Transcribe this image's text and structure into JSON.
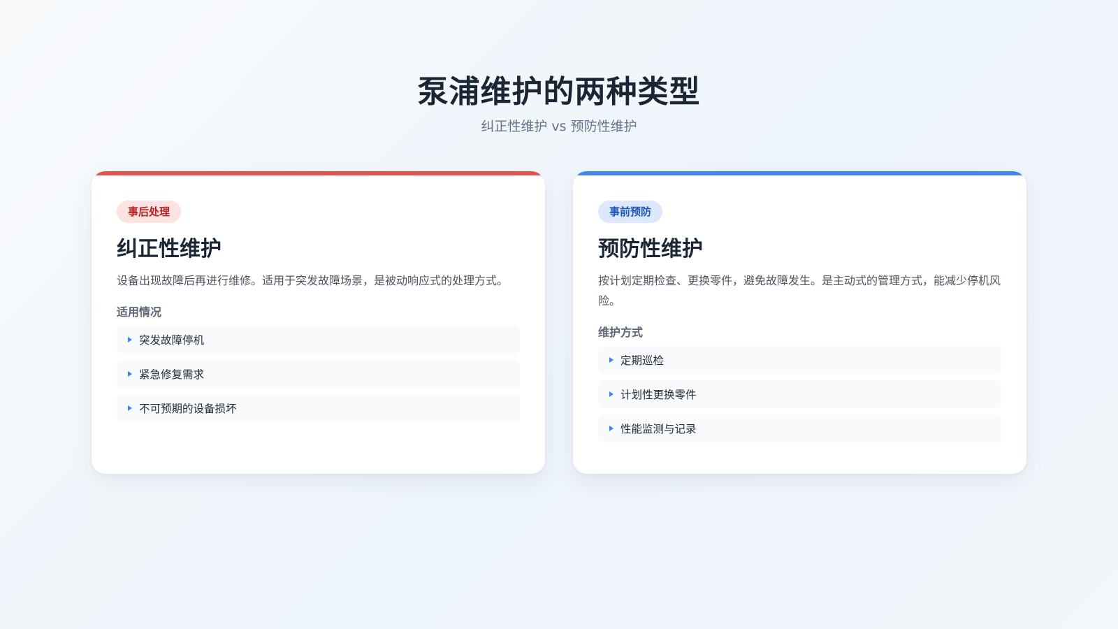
{
  "header": {
    "title": "泵浦维护的两种类型",
    "subtitle": "纠正性维护 vs 预防性维护"
  },
  "colors": {
    "corrective_accent": "#e05252",
    "preventive_accent": "#4383ea",
    "bullet": "#3b82f6"
  },
  "cards": [
    {
      "tag": "事后处理",
      "title": "纠正性维护",
      "description": "设备出现故障后再进行维修。适用于突发故障场景，是被动响应式的处理方式。",
      "section_label": "适用情况",
      "items": [
        "突发故障停机",
        "紧急修复需求",
        "不可预期的设备损坏"
      ]
    },
    {
      "tag": "事前预防",
      "title": "预防性维护",
      "description": "按计划定期检查、更换零件，避免故障发生。是主动式的管理方式，能减少停机风险。",
      "section_label": "维护方式",
      "items": [
        "定期巡检",
        "计划性更换零件",
        "性能监测与记录"
      ]
    }
  ]
}
